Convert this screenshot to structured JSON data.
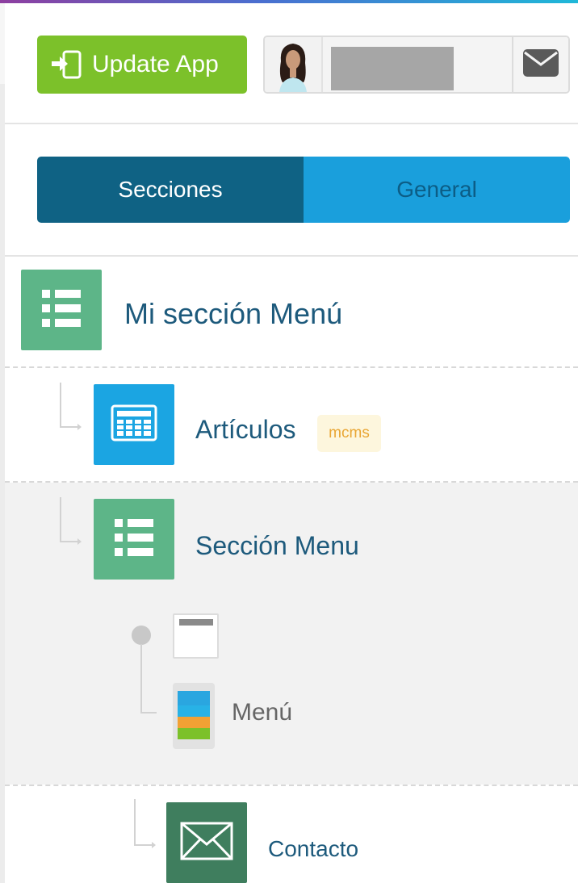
{
  "header": {
    "update_label": "Update App",
    "update_icon": "device-import-icon",
    "avatar_icon": "user-avatar",
    "mail_icon": "envelope-icon"
  },
  "tabs": [
    {
      "label": "Secciones",
      "active": true
    },
    {
      "label": "General",
      "active": false
    }
  ],
  "tree": {
    "root": {
      "label": "Mi sección Menú",
      "icon": "list-icon",
      "color": "#5db588"
    },
    "children": [
      {
        "label": "Artículos",
        "icon": "newspaper-icon",
        "color": "#1ba5e2",
        "badge": "mcms"
      },
      {
        "label": "Sección Menu",
        "icon": "list-icon",
        "color": "#5db588",
        "selected": true,
        "subitems": [
          {
            "label": "Menú",
            "icon": "menu-preview-icon"
          }
        ]
      },
      {
        "label": "Contacto",
        "icon": "envelope-icon",
        "color": "#3f7e5e"
      }
    ]
  },
  "colors": {
    "accent_green": "#7cc12a",
    "tab_active": "#0f6284",
    "tab_inactive": "#1a9fdc",
    "label": "#1d5a7c"
  }
}
